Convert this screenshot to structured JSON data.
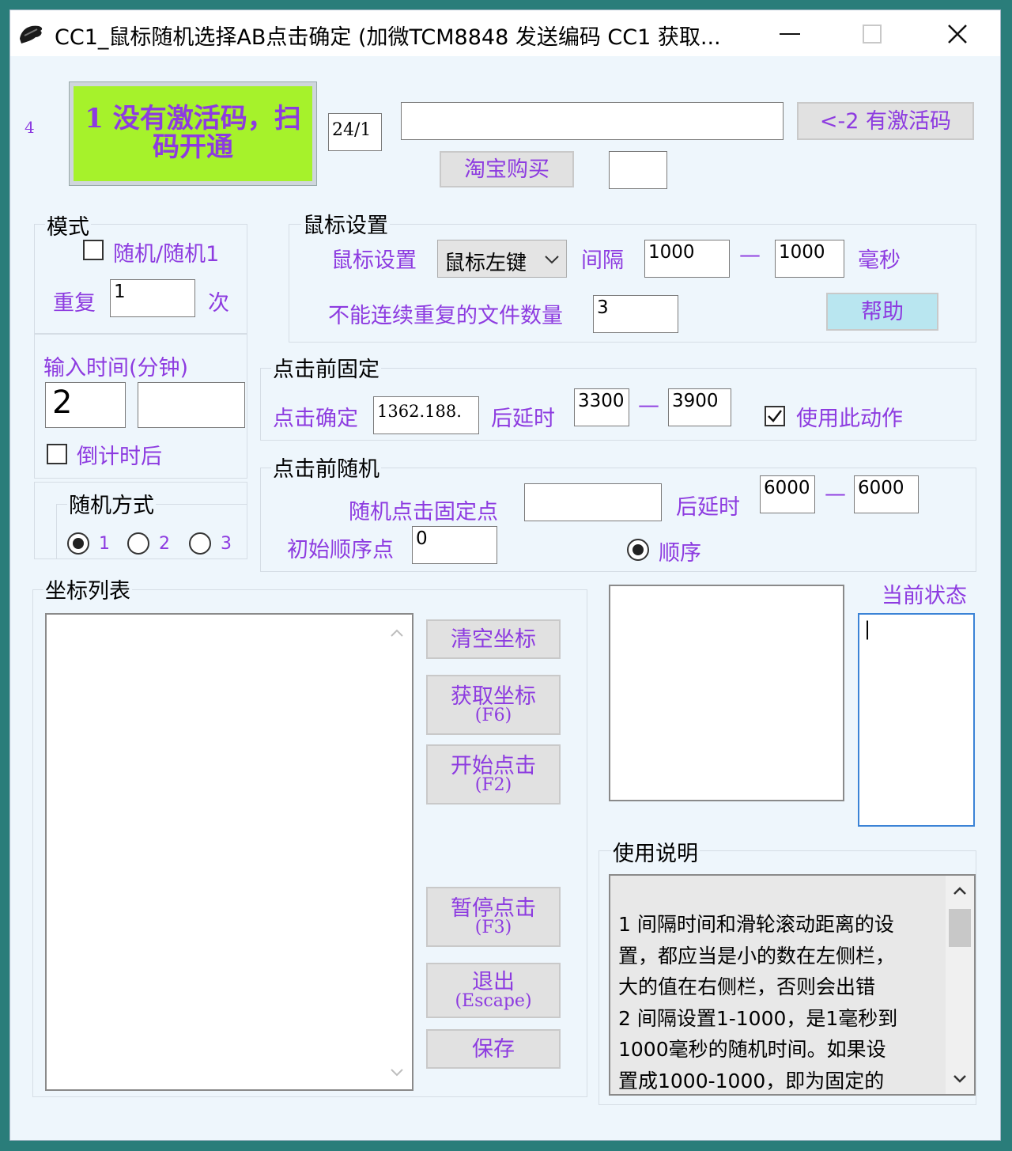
{
  "window": {
    "title": "CC1_鼠标随机选择AB点击确定 (加微TCM8848 发送编码 CC1 获取...",
    "minimize": "—",
    "maximize": "☐",
    "close": "✕"
  },
  "header": {
    "counter": "4",
    "activation_button": "1 没有激活码，扫码开通",
    "version": "24/1",
    "code_input": "",
    "has_code_button": "<-2 有激活码",
    "taobao_button": "淘宝购买",
    "small_input": ""
  },
  "mode": {
    "title": "模式",
    "random_label": "随机/随机1",
    "random_checked": false,
    "repeat_label": "重复",
    "repeat_value": "1",
    "times_label": "次"
  },
  "mouse": {
    "title": "鼠标设置",
    "setting_label": "鼠标设置",
    "button_select": "鼠标左键",
    "interval_label": "间隔",
    "interval_min": "1000",
    "dash": "—",
    "interval_max": "1000",
    "ms_label": "毫秒",
    "no_repeat_label": "不能连续重复的文件数量",
    "no_repeat_value": "3",
    "help_button": "帮助"
  },
  "time": {
    "label": "输入时间(分钟)",
    "value": "2",
    "value2": "",
    "countdown_label": "倒计时后",
    "countdown_checked": false
  },
  "fixed": {
    "title": "点击前固定",
    "confirm_label": "点击确定",
    "confirm_value": "1362.188.",
    "delay_label": "后延时",
    "delay_min": "3300",
    "dash": "—",
    "delay_max": "3900",
    "use_label": "使用此动作",
    "use_checked": true
  },
  "random_mode": {
    "title": "随机方式",
    "options": [
      "1",
      "2",
      "3"
    ],
    "selected": "1"
  },
  "random_click": {
    "title": "点击前随机",
    "fixed_point_label": "随机点击固定点",
    "fixed_point_value": "",
    "delay_label": "后延时",
    "delay_min": "6000",
    "dash": "—",
    "delay_max": "6000",
    "start_label": "初始顺序点",
    "start_value": "0",
    "order_label": "顺序",
    "order_selected": true
  },
  "coords": {
    "title": "坐标列表",
    "items": []
  },
  "actions": {
    "clear": "清空坐标",
    "get": "获取坐标",
    "get_key": "(F6)",
    "start": "开始点击",
    "start_key": "(F2)",
    "pause": "暂停点击",
    "pause_key": "(F3)",
    "exit": "退出",
    "exit_key": "(Escape)",
    "save": "保存"
  },
  "status": {
    "label": "当前状态",
    "value": "|"
  },
  "instructions": {
    "title": "使用说明",
    "lines": [
      "1 间隔时间和滑轮滚动距离的设",
      "置，都应当是小的数在左侧栏，",
      "大的值在右侧栏，否则会出错",
      "2 间隔设置1-1000，是1毫秒到",
      "1000毫秒的随机时间。如果设",
      "置成1000-1000，即为固定的"
    ]
  },
  "colors": {
    "accent_purple": "#8d3be0",
    "activation_green": "#a6f22b",
    "help_blue": "#b9e6f0",
    "status_border": "#3b83d6"
  }
}
